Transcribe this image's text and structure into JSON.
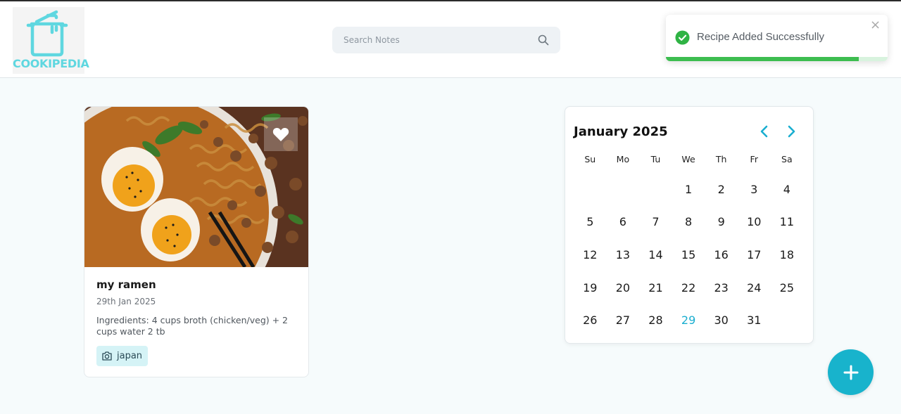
{
  "app": {
    "logo_text": "COOKIPEDIA"
  },
  "search": {
    "placeholder": "Search Notes",
    "value": ""
  },
  "toast": {
    "message": "Recipe Added Successfully",
    "close_label": "×",
    "progress": 0.87,
    "status_color": "#3dbd50"
  },
  "recipes": [
    {
      "title": "my ramen",
      "date": "29th Jan 2025",
      "description": "Ingredients: 4 cups broth (chicken/veg) + 2 cups water 2 tb",
      "tag": "japan"
    }
  ],
  "calendar": {
    "month": "January",
    "year": "2025",
    "weekdays": [
      "Su",
      "Mo",
      "Tu",
      "We",
      "Th",
      "Fr",
      "Sa"
    ],
    "first_weekday_index": 3,
    "days_in_month": 31,
    "today": 29,
    "accent_color": "#1aaed0"
  },
  "fab": {
    "label": "+",
    "color": "#18b3cc"
  },
  "icons": {
    "search": "search-icon",
    "check": "check-circle-icon",
    "heart": "heart-icon",
    "tag": "camera-icon",
    "prev": "chevron-left-icon",
    "next": "chevron-right-icon",
    "add": "plus-icon"
  }
}
